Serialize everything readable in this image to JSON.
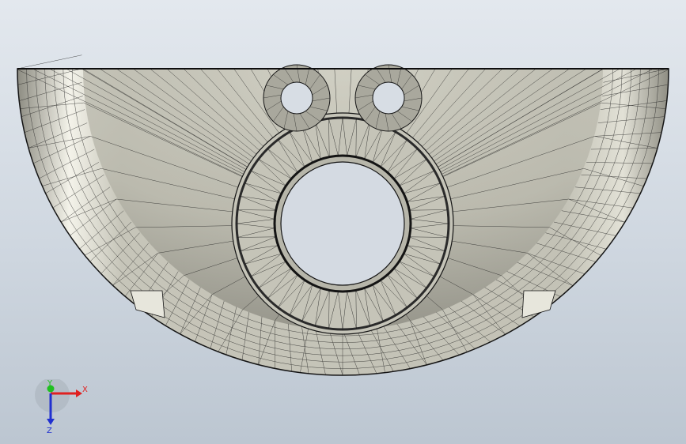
{
  "viewport": {
    "background_top": "#e3e8ee",
    "background_bottom": "#bcc6d1"
  },
  "part": {
    "fill": "#c9c8bc",
    "shade": "#9f9e93",
    "highlight": "#f3f2e8",
    "edge": "#141414",
    "render_style": "shaded-with-mesh"
  },
  "triad": {
    "x_label": "X",
    "y_label": "Y",
    "z_label": "Z",
    "x_color": "#e02020",
    "y_color": "#20c020",
    "z_color": "#2030d0"
  }
}
